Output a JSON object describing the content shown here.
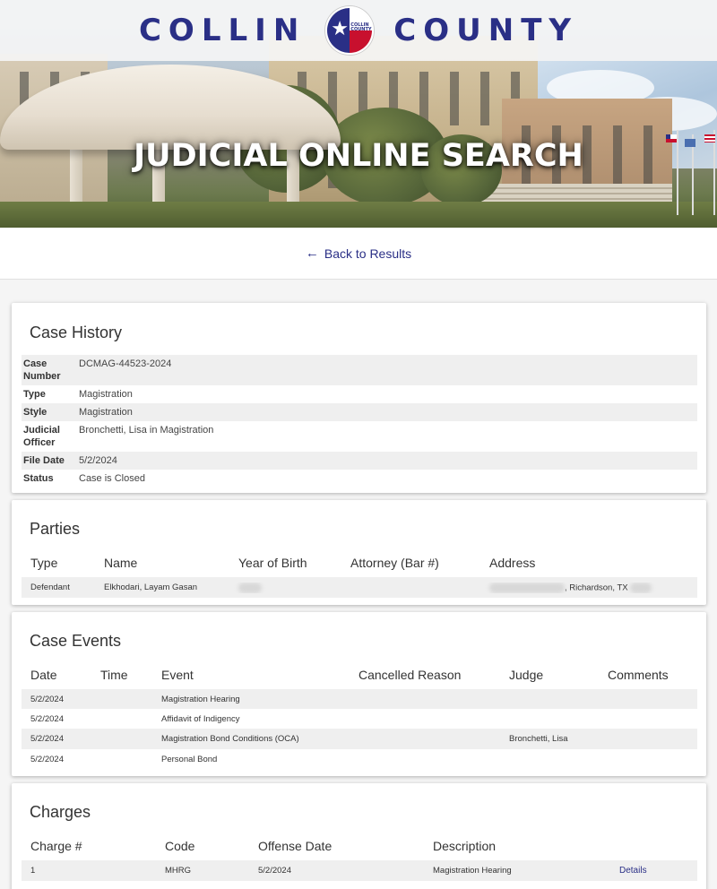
{
  "header": {
    "logo_left": "COLLIN",
    "logo_right": "COUNTY",
    "seal_text_1": "COLLIN",
    "seal_text_2": "COUNTY",
    "title": "JUDICIAL ONLINE SEARCH",
    "brand_color": "#2a2f86",
    "accent_color": "#c8102e"
  },
  "nav": {
    "back_label": "Back to Results",
    "back_icon": "arrow-left-icon"
  },
  "case_history": {
    "title": "Case History",
    "rows": [
      {
        "key": "Case Number",
        "value": "DCMAG-44523-2024"
      },
      {
        "key": "Type",
        "value": "Magistration"
      },
      {
        "key": "Style",
        "value": "Magistration"
      },
      {
        "key": "Judicial Officer",
        "value": "Bronchetti, Lisa in Magistration"
      },
      {
        "key": "File Date",
        "value": "5/2/2024"
      },
      {
        "key": "Status",
        "value": "Case is Closed"
      }
    ]
  },
  "parties": {
    "title": "Parties",
    "columns": [
      "Type",
      "Name",
      "Year of Birth",
      "Attorney (Bar #)",
      "Address"
    ],
    "rows": [
      {
        "type": "Defendant",
        "name": "Elkhodari, Layam Gasan",
        "address_visible": ", Richardson, TX"
      }
    ]
  },
  "case_events": {
    "title": "Case Events",
    "columns": [
      "Date",
      "Time",
      "Event",
      "Cancelled Reason",
      "Judge",
      "Comments"
    ],
    "rows": [
      {
        "date": "5/2/2024",
        "time": "",
        "event": "Magistration Hearing",
        "cancelled": "",
        "judge": "",
        "comments": ""
      },
      {
        "date": "5/2/2024",
        "time": "",
        "event": "Affidavit of Indigency",
        "cancelled": "",
        "judge": "",
        "comments": ""
      },
      {
        "date": "5/2/2024",
        "time": "",
        "event": "Magistration Bond Conditions (OCA)",
        "cancelled": "",
        "judge": "Bronchetti, Lisa",
        "comments": ""
      },
      {
        "date": "5/2/2024",
        "time": "",
        "event": "Personal Bond",
        "cancelled": "",
        "judge": "",
        "comments": ""
      }
    ]
  },
  "charges": {
    "title": "Charges",
    "columns": [
      "Charge #",
      "Code",
      "Offense Date",
      "Description"
    ],
    "rows": [
      {
        "charge": "1",
        "code": "MHRG",
        "offense_date": "5/2/2024",
        "description": "Magistration Hearing",
        "details": "Details"
      }
    ]
  }
}
